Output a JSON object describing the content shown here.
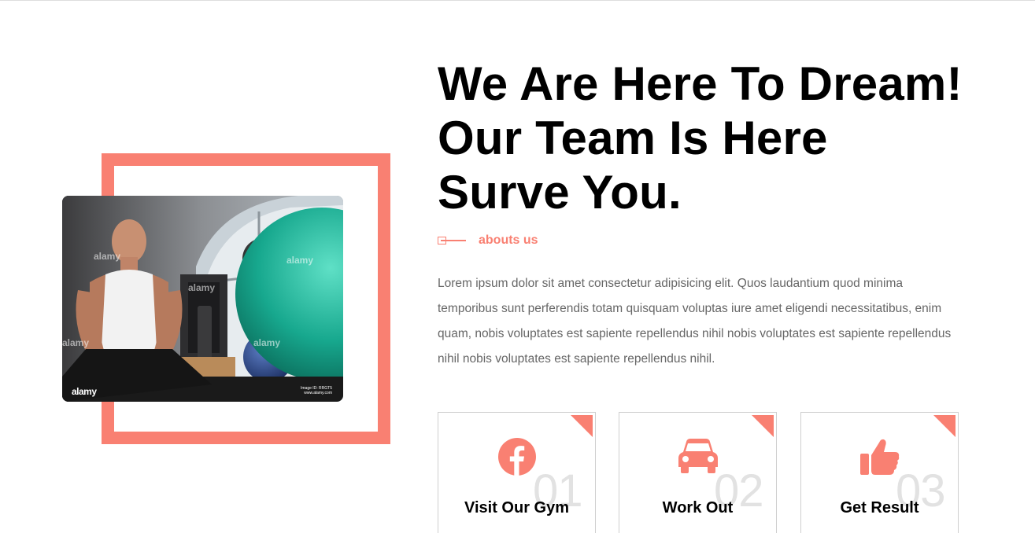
{
  "hero": {
    "headline_lines": [
      "We Are Here To Dream!",
      "Our Team Is Here",
      "Surve You."
    ],
    "section_tag": "abouts us",
    "description": "Lorem ipsum dolor sit amet consectetur adipisicing elit. Quos laudantium quod minima temporibus sunt perferendis totam quisquam voluptas iure amet eligendi necessitatibus, enim quam, nobis voluptates est sapiente repellendus nihil nobis voluptates est sapiente repellendus nihil nobis voluptates est sapiente repellendus nihil."
  },
  "photo": {
    "watermark": "alamy",
    "watermark_id_line1": "Image ID: RRGT5",
    "watermark_id_line2": "www.alamy.com"
  },
  "features": [
    {
      "number": "01",
      "title": "Visit Our Gym",
      "icon": "facebook-icon"
    },
    {
      "number": "02",
      "title": "Work Out",
      "icon": "car-icon"
    },
    {
      "number": "03",
      "title": "Get Result",
      "icon": "thumbs-up-icon"
    }
  ],
  "colors": {
    "accent": "#f98072",
    "text": "#000000",
    "muted_text": "#666666",
    "card_border": "#cfcfcf",
    "number_gray": "#e2e2e2"
  }
}
